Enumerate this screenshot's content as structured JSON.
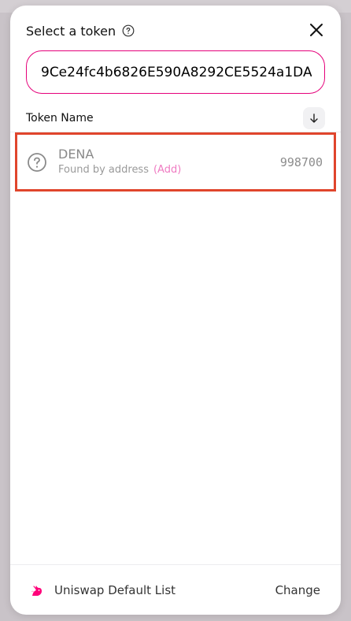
{
  "modal": {
    "title": "Select a token",
    "help_icon": "question-circle-icon",
    "close_icon": "close-icon"
  },
  "search": {
    "value": "9Ce24fc4b6826E590A8292CE5524a1DA",
    "accent_color": "#e5007a"
  },
  "list": {
    "header_label": "Token Name",
    "sort_icon": "arrow-down-icon",
    "tokens": [
      {
        "symbol": "DENA",
        "subtitle": "Found by address",
        "add_label": "(Add)",
        "balance": "998700",
        "icon": "question-circle-icon",
        "highlighted": true,
        "highlight_color": "#e0452c"
      }
    ]
  },
  "footer": {
    "list_name": "Uniswap Default List",
    "change_label": "Change",
    "logo_icon": "uniswap-unicorn-icon"
  }
}
